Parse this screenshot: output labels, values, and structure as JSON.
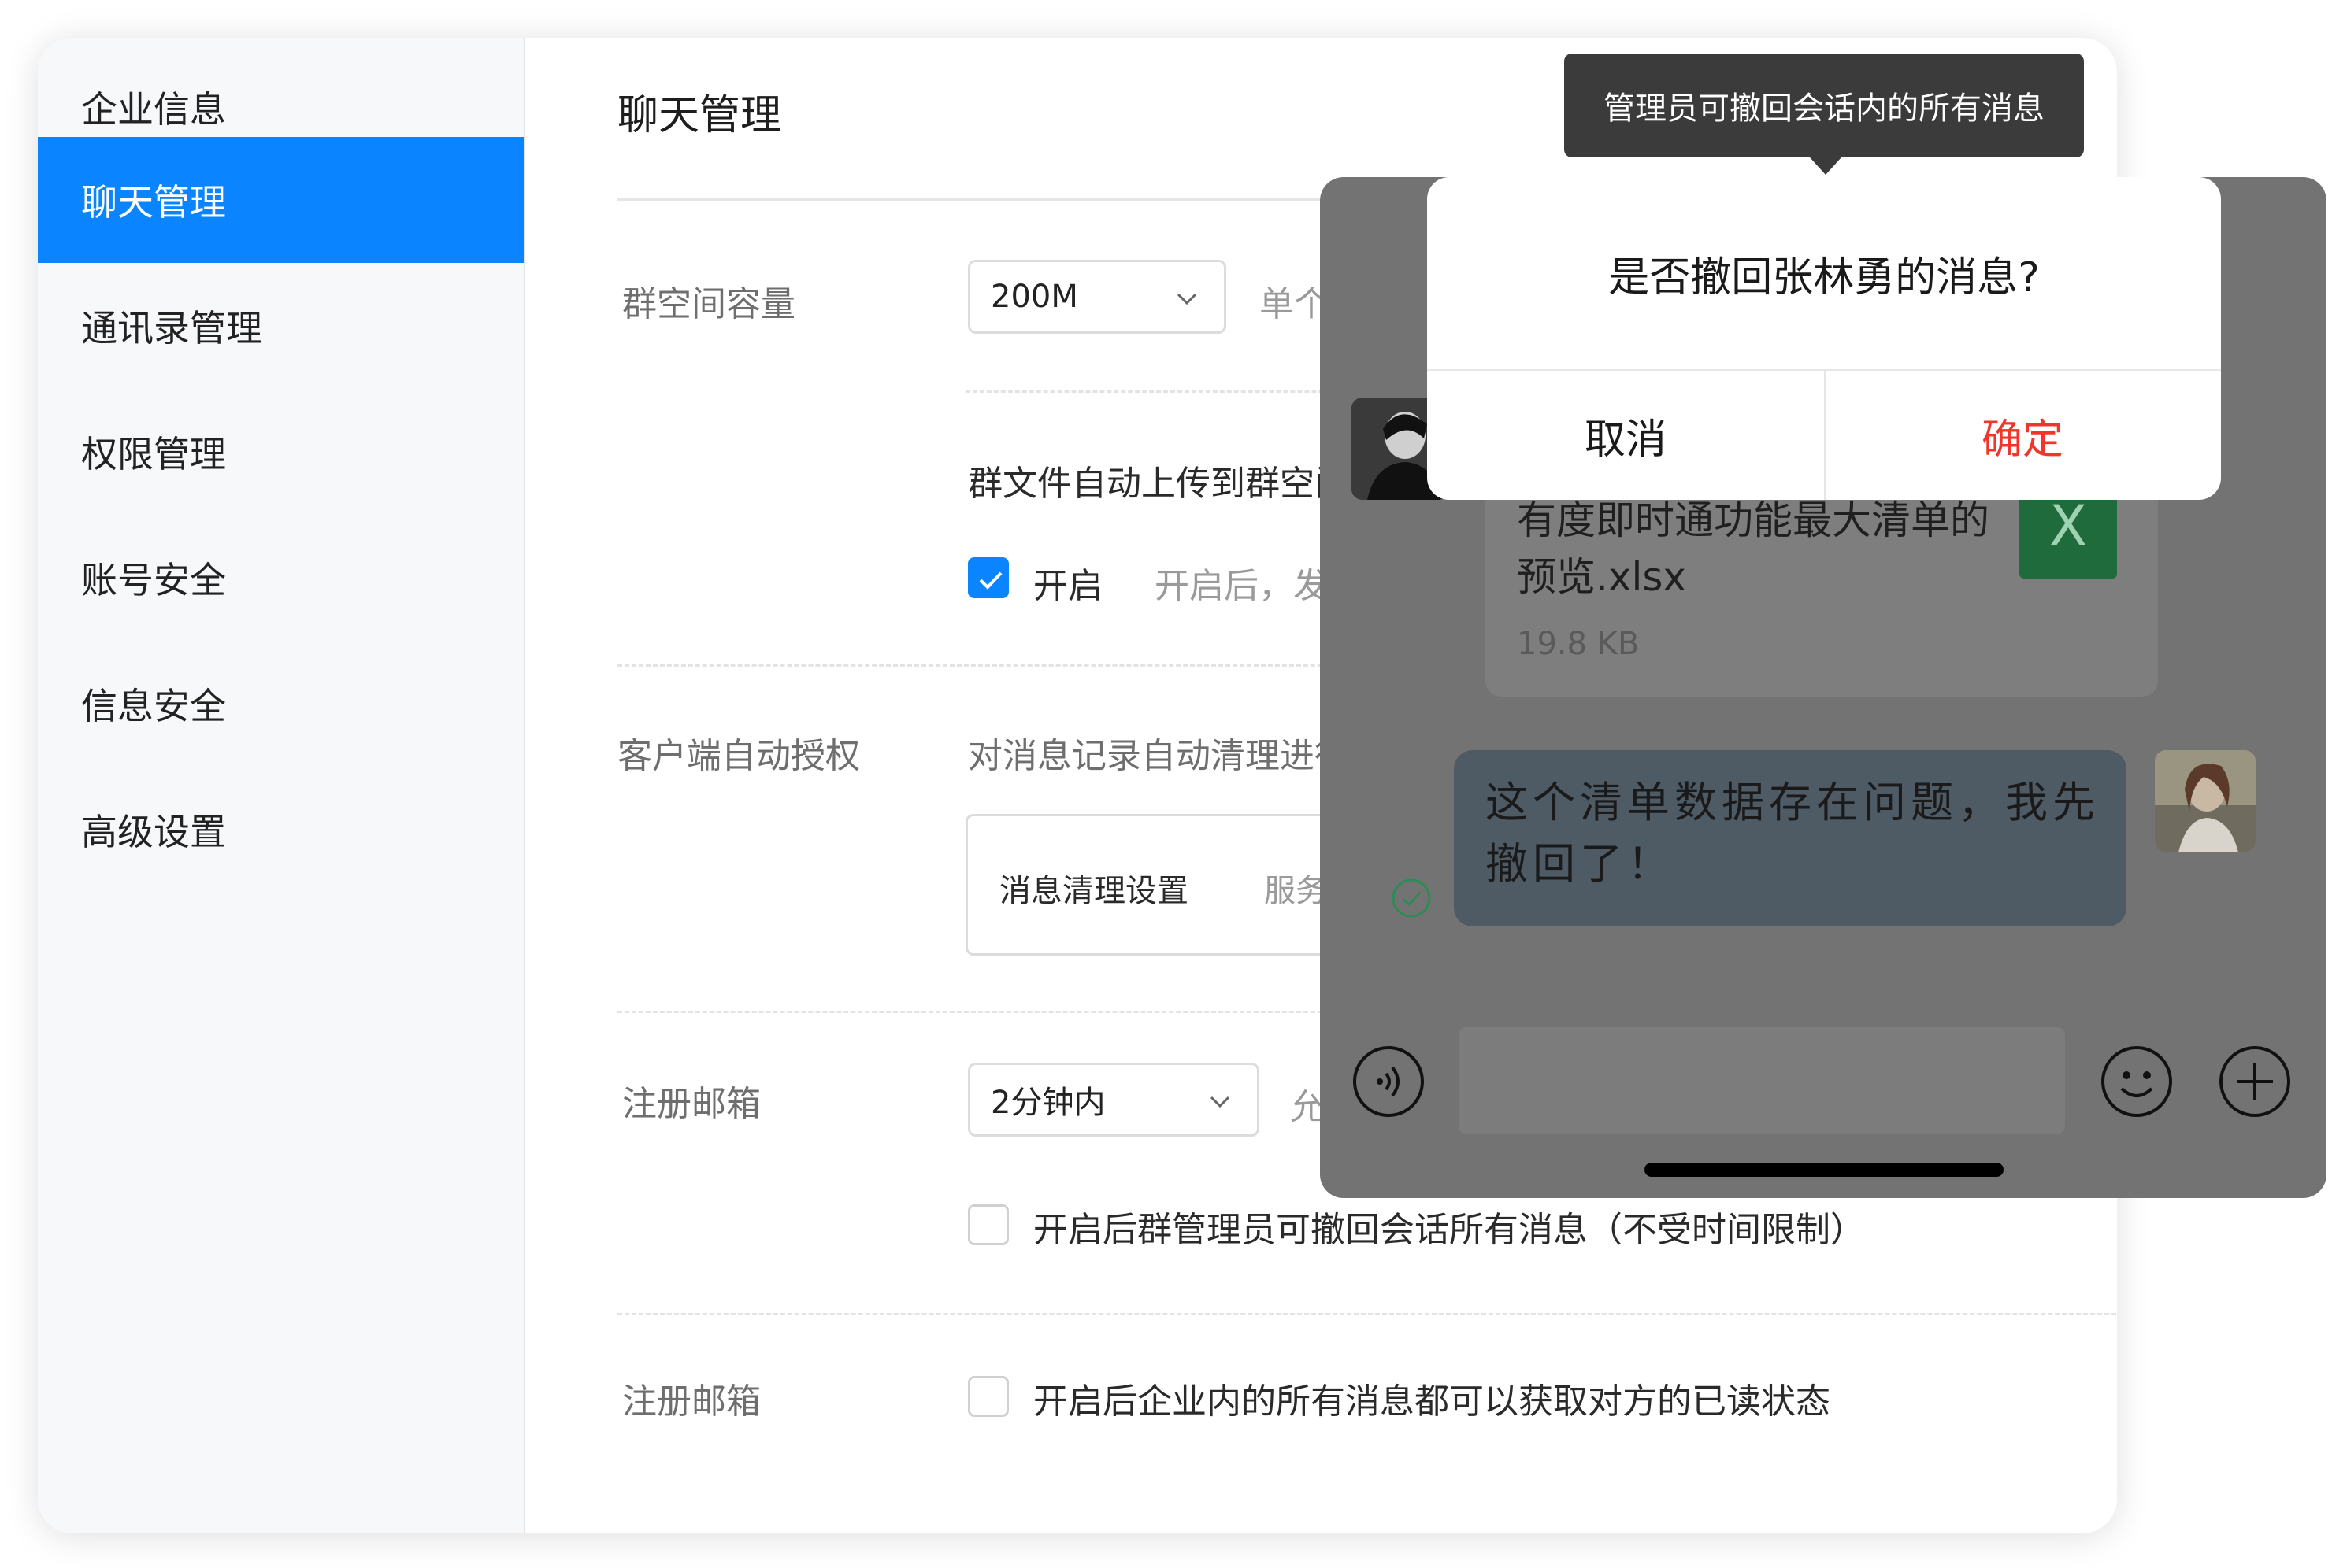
{
  "sidebar": {
    "items": [
      {
        "label": "企业信息"
      },
      {
        "label": "聊天管理",
        "active": true
      },
      {
        "label": "通讯录管理"
      },
      {
        "label": "权限管理"
      },
      {
        "label": "账号安全"
      },
      {
        "label": "信息安全"
      },
      {
        "label": "高级设置"
      }
    ]
  },
  "main": {
    "title": "聊天管理",
    "group_space": {
      "label": "群空间容量",
      "select_value": "200M",
      "hint": "单个群",
      "auto_upload_text": "群文件自动上传到群空间",
      "enable_label": "开启",
      "enable_hint": "开启后，发送"
    },
    "client_auth": {
      "label": "客户端自动授权",
      "desc": "对消息记录自动清理进行",
      "setting_label": "消息清理设置",
      "setting_hint": "服务器"
    },
    "recall": {
      "label": "注册邮箱",
      "select_value": "2分钟内",
      "hint": "允许",
      "checkbox_text": "开启后群管理员可撤回会话所有消息（不受时间限制）"
    },
    "read_status": {
      "label": "注册邮箱",
      "checkbox_text": "开启后企业内的所有消息都可以获取对方的已读状态"
    }
  },
  "tooltip": {
    "text": "管理员可撤回会话内的所有消息"
  },
  "phone": {
    "file": {
      "name": "有度即时通功能最大清单的预览.xlsx",
      "size": "19.8 KB",
      "icon_letter": "X"
    },
    "message": "这个清单数据存在问题，我先撤回了！",
    "dialog": {
      "title": "是否撤回张林勇的消息?",
      "cancel": "取消",
      "confirm": "确定"
    },
    "colors": {
      "confirm": "#f0362a",
      "accent": "#0a84ff"
    }
  }
}
